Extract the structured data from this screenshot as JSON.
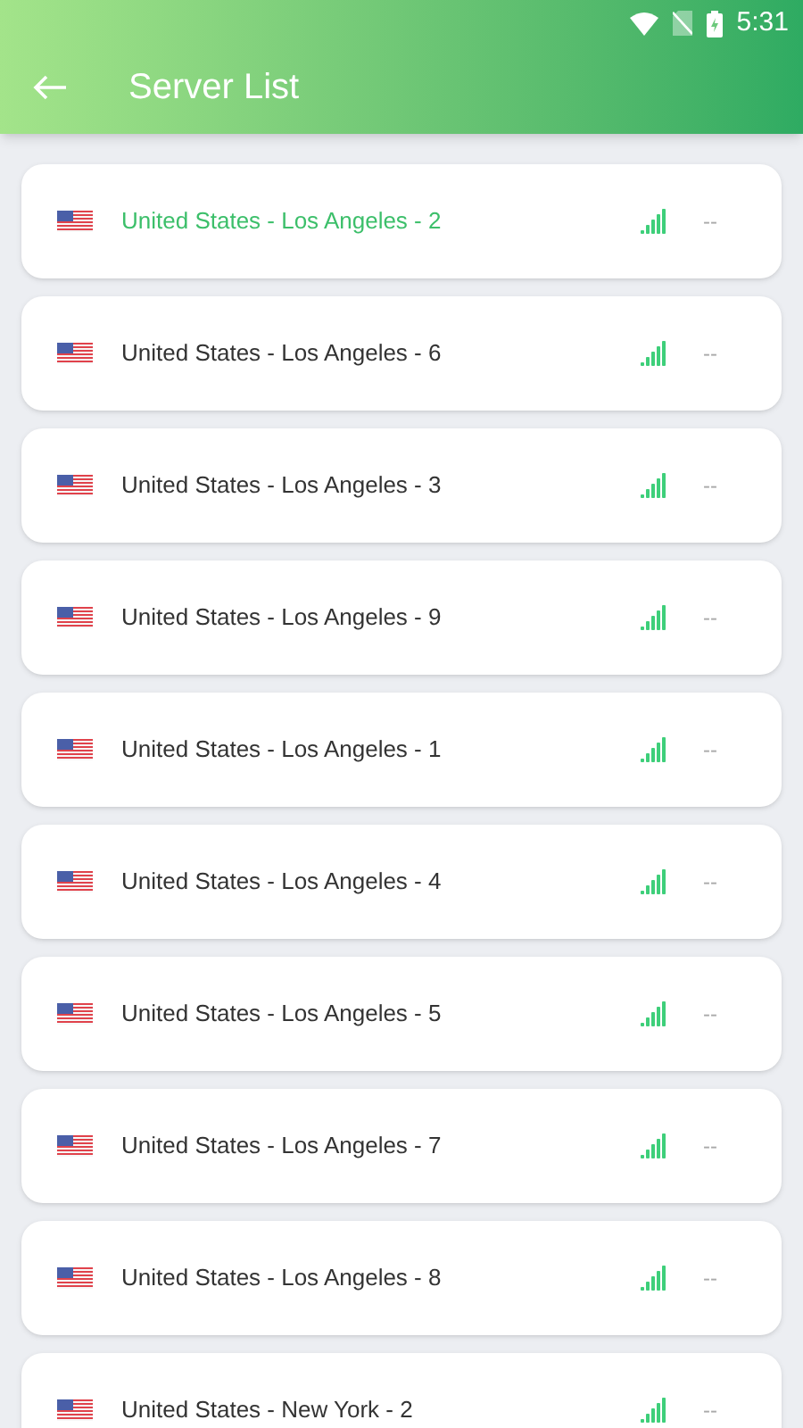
{
  "status_bar": {
    "time": "5:31"
  },
  "header": {
    "title": "Server List"
  },
  "servers": [
    {
      "name": "United States - Los Angeles - 2",
      "ping": "--",
      "selected": true
    },
    {
      "name": "United States - Los Angeles - 6",
      "ping": "--",
      "selected": false
    },
    {
      "name": "United States - Los Angeles - 3",
      "ping": "--",
      "selected": false
    },
    {
      "name": "United States - Los Angeles - 9",
      "ping": "--",
      "selected": false
    },
    {
      "name": "United States - Los Angeles - 1",
      "ping": "--",
      "selected": false
    },
    {
      "name": "United States - Los Angeles - 4",
      "ping": "--",
      "selected": false
    },
    {
      "name": "United States - Los Angeles - 5",
      "ping": "--",
      "selected": false
    },
    {
      "name": "United States - Los Angeles - 7",
      "ping": "--",
      "selected": false
    },
    {
      "name": "United States - Los Angeles - 8",
      "ping": "--",
      "selected": false
    },
    {
      "name": "United States - New York - 2",
      "ping": "--",
      "selected": false
    }
  ]
}
